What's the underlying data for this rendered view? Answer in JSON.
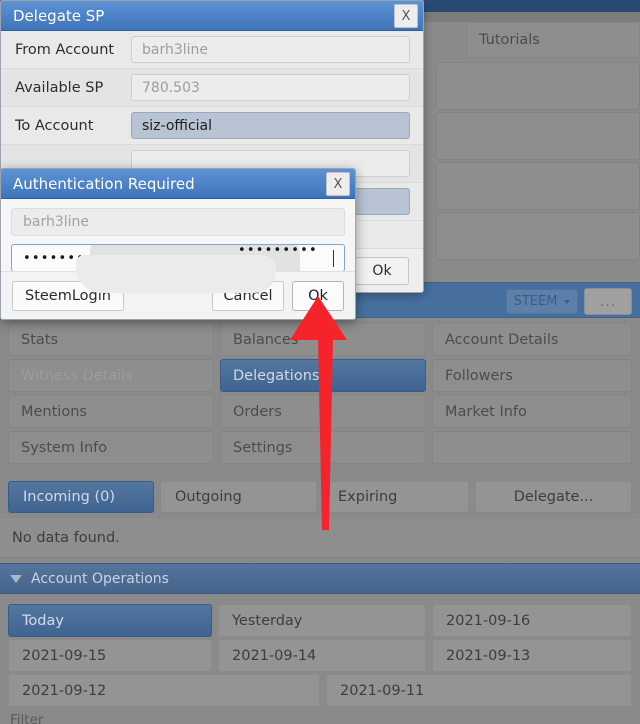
{
  "colors": {
    "accent_blue": "#4f86c6",
    "title_blue": "#3f74bb",
    "selected_blue": "#46658d",
    "arrow_red": "#f5232a",
    "backdrop_grey": "#8a8a8a"
  },
  "delegate_dialog": {
    "title": "Delegate SP",
    "close_label": "X",
    "rows": [
      {
        "label": "From Account",
        "value": "barh3line",
        "state": "placeholder"
      },
      {
        "label": "Available SP",
        "value": "780.503",
        "state": "placeholder"
      },
      {
        "label": "To Account",
        "value": "siz-official",
        "state": "filled"
      },
      {
        "label": "",
        "value": "",
        "state": "blank"
      },
      {
        "label": "",
        "value": "",
        "state": "blank"
      }
    ],
    "ok_label": "Ok"
  },
  "auth_dialog": {
    "title": "Authentication Required",
    "close_label": "X",
    "username_placeholder": "barh3line",
    "password_masked": "•••••••••••••",
    "password_masked_tail": "•••••••••",
    "steemlogin_label": "SteemLogin",
    "cancel_label": "Cancel",
    "ok_label": "Ok"
  },
  "background": {
    "tutorials_label": "Tutorials",
    "toolbar": {
      "currency_label": "STEEM",
      "more_label": "..."
    },
    "nav_grid": [
      {
        "label": "Stats",
        "state": "normal"
      },
      {
        "label": "Balances",
        "state": "normal"
      },
      {
        "label": "Account Details",
        "state": "normal"
      },
      {
        "label": "Witness Details",
        "state": "disabled"
      },
      {
        "label": "Delegations",
        "state": "selected"
      },
      {
        "label": "Followers",
        "state": "normal"
      },
      {
        "label": "Mentions",
        "state": "normal"
      },
      {
        "label": "Orders",
        "state": "normal"
      },
      {
        "label": "Market Info",
        "state": "normal"
      },
      {
        "label": "System Info",
        "state": "normal"
      },
      {
        "label": "Settings",
        "state": "normal"
      },
      {
        "label": "",
        "state": "normal"
      }
    ],
    "delegation_tabs": [
      {
        "label": "Incoming (0)",
        "active": true
      },
      {
        "label": "Outgoing",
        "active": false
      },
      {
        "label": "Expiring",
        "active": false
      },
      {
        "label": "Delegate...",
        "active": false
      }
    ],
    "empty_message": "No data found.",
    "operations_section": {
      "title": "Account Operations",
      "collapse_icon": "triangle-down"
    },
    "date_buttons": [
      {
        "label": "Today",
        "active": true
      },
      {
        "label": "Yesterday",
        "active": false
      },
      {
        "label": "2021-09-16",
        "active": false
      },
      {
        "label": "2021-09-15",
        "active": false
      },
      {
        "label": "2021-09-14",
        "active": false
      },
      {
        "label": "2021-09-13",
        "active": false
      },
      {
        "label": "2021-09-12",
        "active": false
      },
      {
        "label": "2021-09-11",
        "active": false
      }
    ],
    "filter_label": "Filter"
  },
  "annotation": {
    "type": "red-arrow",
    "points_to": "auth-ok-button"
  }
}
